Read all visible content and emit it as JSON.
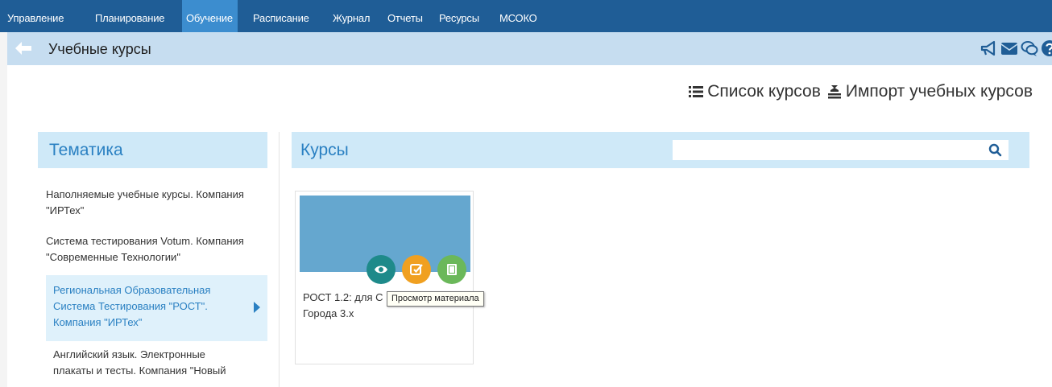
{
  "nav": {
    "items": [
      {
        "label": "Управление"
      },
      {
        "label": "Планирование"
      },
      {
        "label": "Обучение",
        "active": true
      },
      {
        "label": "Расписание"
      },
      {
        "label": "Журнал"
      },
      {
        "label": "Отчеты"
      },
      {
        "label": "Ресурсы"
      },
      {
        "label": "МСОКО"
      }
    ]
  },
  "header": {
    "title": "Учебные курсы",
    "icons": [
      "megaphone-icon",
      "envelope-icon",
      "chat-icon",
      "help-icon"
    ]
  },
  "actions": {
    "course_list": "Список курсов",
    "import_courses": "Импорт учебных курсов"
  },
  "topics": {
    "title": "Тематика",
    "items": [
      {
        "label": "Наполняемые учебные курсы. Компания \"ИРТех\""
      },
      {
        "label": "Система тестирования Votum. Компания \"Современные Технологии\""
      },
      {
        "label": "Региональная Образовательная Система Тестирования \"РОСТ\". Компания \"ИРТех\"",
        "active": true
      },
      {
        "label": "Английский язык. Электронные плакаты и тесты. Компания \"Новый"
      }
    ]
  },
  "courses": {
    "title": "Курсы",
    "search": {
      "value": "",
      "placeholder": ""
    },
    "cards": [
      {
        "title_line1": "РОСТ 1.2: для С",
        "title_line2": "Города 3.x"
      }
    ],
    "tooltip": "Просмотр материала"
  },
  "colors": {
    "nav_bg": "#1f5d96",
    "nav_active": "#3c8dcf",
    "subheader_bg": "#c6ddf0",
    "panel_head_bg": "#cfe9f8",
    "accent": "#2a80c2",
    "card_image": "#65a7cf",
    "view_btn": "#1e8a8a",
    "edit_btn": "#f0a020",
    "book_btn": "#6bb85a"
  }
}
